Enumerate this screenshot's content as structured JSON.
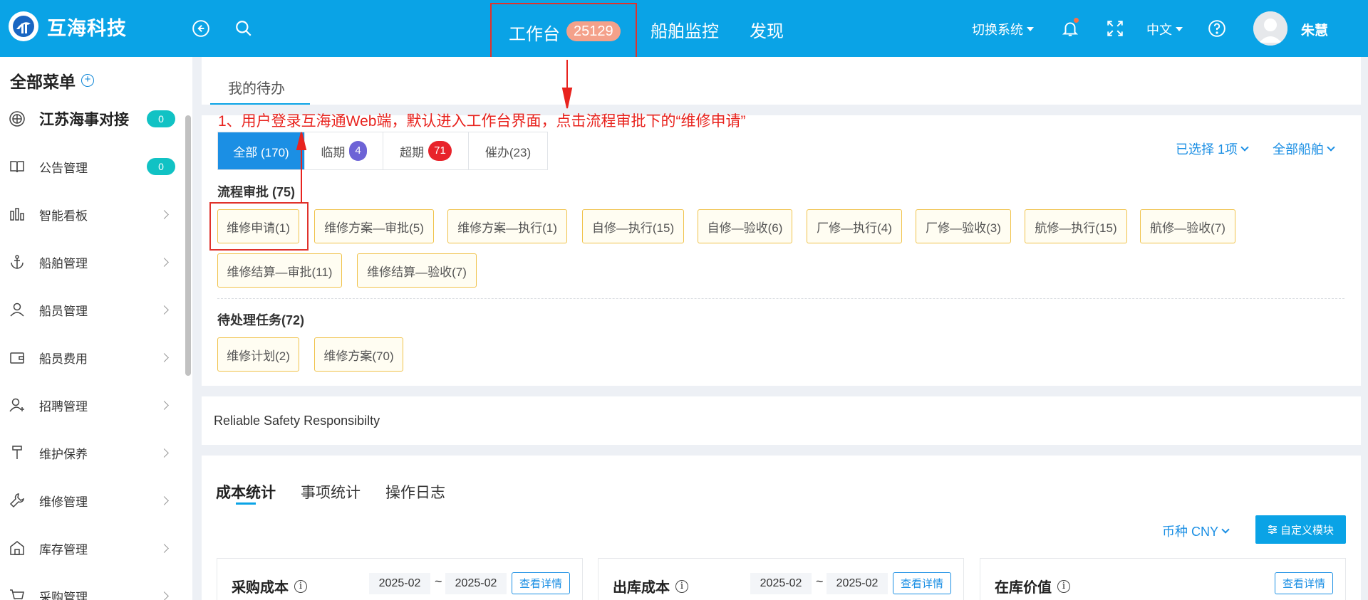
{
  "header": {
    "brand": "互海科技",
    "nav_main_label": "工作台",
    "nav_main_badge": "25129",
    "nav_links": [
      "船舶监控",
      "发现"
    ],
    "switch_system": "切换系统",
    "language": "中文",
    "username": "朱慧",
    "icons": [
      "back-circle-icon",
      "search-icon",
      "bell-icon",
      "fullscreen-icon",
      "help-icon"
    ]
  },
  "sidebar": {
    "title": "全部菜单",
    "items": [
      {
        "label": "江苏海事对接",
        "icon": "compass-icon",
        "badge": "0"
      },
      {
        "label": "公告管理",
        "icon": "book-icon",
        "badge": "0"
      },
      {
        "label": "智能看板",
        "icon": "bar-chart-icon"
      },
      {
        "label": "船舶管理",
        "icon": "anchor-icon"
      },
      {
        "label": "船员管理",
        "icon": "person-icon"
      },
      {
        "label": "船员费用",
        "icon": "wallet-icon"
      },
      {
        "label": "招聘管理",
        "icon": "person-add-icon"
      },
      {
        "label": "维护保养",
        "icon": "hammer-icon"
      },
      {
        "label": "维修管理",
        "icon": "wrench-icon"
      },
      {
        "label": "库存管理",
        "icon": "warehouse-icon"
      },
      {
        "label": "采购管理",
        "icon": "cart-icon"
      }
    ]
  },
  "main": {
    "tab_label": "我的待办",
    "annotation": "1、用户登录互海通Web端，默认进入工作台界面，点击流程审批下的“维修申请”",
    "filters": {
      "all": "全部 (170)",
      "near_label": "临期",
      "near_count": "4",
      "overdue_label": "超期",
      "overdue_count": "71",
      "urge": "催办(23)"
    },
    "selected": "已选择 1项",
    "all_ships": "全部船舶",
    "approval_title": "流程审批 (75)",
    "approval_tags": [
      "维修申请(1)",
      "维修方案—审批(5)",
      "维修方案—执行(1)",
      "自修—执行(15)",
      "自修—验收(6)",
      "厂修—执行(4)",
      "厂修—验收(3)",
      "航修—执行(15)",
      "航修—验收(7)",
      "维修结算—审批(11)",
      "维修结算—验收(7)"
    ],
    "pending_title": "待处理任务(72)",
    "pending_tags": [
      "维修计划(2)",
      "维修方案(70)"
    ],
    "motto": "Reliable Safety Responsibilty",
    "stat_tabs": [
      "成本统计",
      "事项统计",
      "操作日志"
    ],
    "currency": "币种 CNY",
    "custom_button": "自定义模块",
    "cards": [
      {
        "title": "采购成本",
        "date_from": "2025-02",
        "date_to": "2025-02",
        "detail": "查看详情"
      },
      {
        "title": "出库成本",
        "date_from": "2025-02",
        "date_to": "2025-02",
        "detail": "查看详情"
      },
      {
        "title": "在库价值",
        "detail": "查看详情"
      }
    ],
    "tilde": "~"
  },
  "colors": {
    "topbar": "#0aa3e6",
    "accent": "#1b8fe4",
    "annotation_red": "#e8231e",
    "tag_border": "#f0c24a",
    "badge_teal": "#11c2c4"
  }
}
